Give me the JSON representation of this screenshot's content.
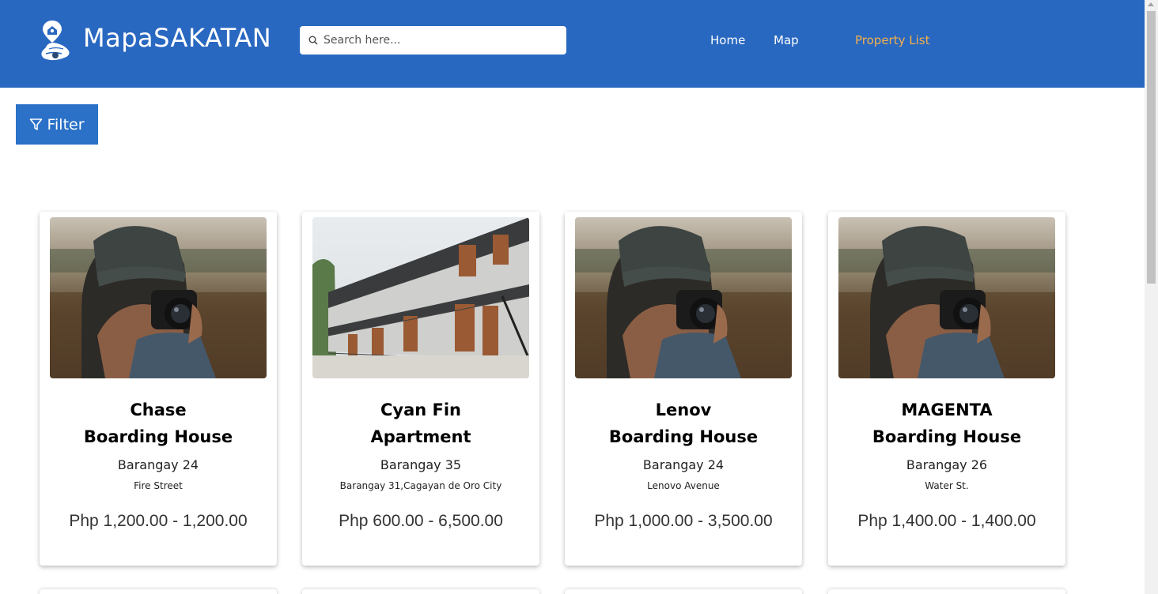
{
  "header": {
    "brand": "MapaSAKATAN",
    "search_placeholder": "Search here...",
    "nav": [
      {
        "label": "Home",
        "active": false
      },
      {
        "label": "Map",
        "active": false
      },
      {
        "label": "Property List",
        "active": true
      }
    ]
  },
  "filter": {
    "label": "Filter"
  },
  "properties": [
    {
      "name_line1": "Chase",
      "name_line2": "Boarding House",
      "barangay": "Barangay 24",
      "street": "Fire Street",
      "price": "Php 1,200.00 - 1,200.00",
      "image": "photographer-photo"
    },
    {
      "name_line1": "Cyan Fin",
      "name_line2": "Apartment",
      "barangay": "Barangay 35",
      "street": "Barangay 31,Cagayan de Oro City",
      "price": "Php 600.00 - 6,500.00",
      "image": "apartment-building-photo"
    },
    {
      "name_line1": "Lenov",
      "name_line2": "Boarding House",
      "barangay": "Barangay 24",
      "street": "Lenovo Avenue",
      "price": "Php 1,000.00 - 3,500.00",
      "image": "photographer-photo"
    },
    {
      "name_line1": "MAGENTA",
      "name_line2": "Boarding House",
      "barangay": "Barangay 26",
      "street": "Water St.",
      "price": "Php 1,400.00 - 1,400.00",
      "image": "photographer-photo"
    }
  ],
  "colors": {
    "navbar": "#2968c0",
    "accent_active": "#f3b04c",
    "filter_button": "#2a71c7"
  }
}
